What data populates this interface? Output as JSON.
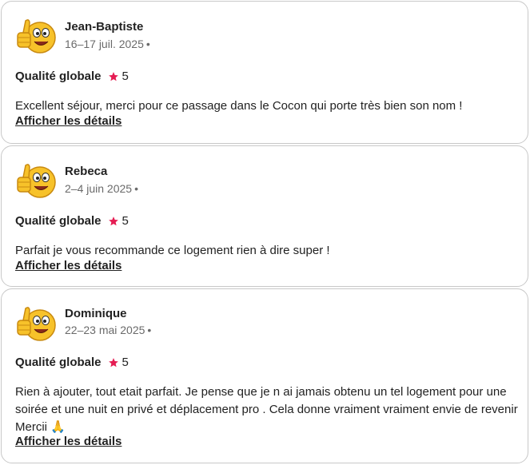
{
  "rating_label": "Qualité globale",
  "details_label": "Afficher les détails",
  "colors": {
    "star": "#e51d53",
    "meta": "#6a6a6a",
    "border": "#c8c8c8"
  },
  "reviews": [
    {
      "name": "Jean-Baptiste",
      "dates": "16–17 juil. 2025",
      "separator": "•",
      "rating": "5",
      "comment": "Excellent séjour, merci pour ce passage dans le Cocon qui porte très bien son nom !",
      "avatar_icon": "thumbs-up-emoji-icon"
    },
    {
      "name": "Rebeca",
      "dates": "2–4 juin 2025",
      "separator": "•",
      "rating": "5",
      "comment": "Parfait je vous recommande ce logement rien à dire super !",
      "avatar_icon": "thumbs-up-emoji-icon"
    },
    {
      "name": "Dominique",
      "dates": "22–23 mai 2025",
      "separator": "•",
      "rating": "5",
      "comment": "Rien à ajouter, tout etait parfait. Je pense que je n ai jamais obtenu un tel logement pour une soirée et une nuit en privé et déplacement pro . Cela donne vraiment vraiment envie de revenir Mercii 🙏",
      "avatar_icon": "thumbs-up-emoji-icon"
    }
  ]
}
